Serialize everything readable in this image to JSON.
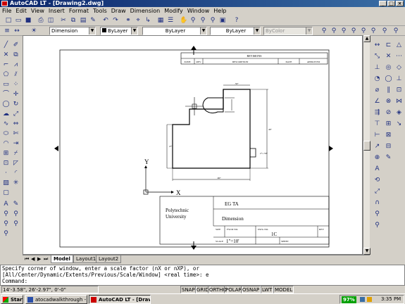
{
  "window": {
    "title": "AutoCAD LT - [Drawing2.dwg]",
    "buttons": [
      "_",
      "□",
      "×"
    ]
  },
  "menu": [
    "File",
    "Edit",
    "View",
    "Insert",
    "Format",
    "Tools",
    "Draw",
    "Dimension",
    "Modify",
    "Window",
    "Help"
  ],
  "props": {
    "dimstyle": "Dimension",
    "layer": "ByLayer",
    "linetype": "ByLayer",
    "lineweight": "ByLayer",
    "color": "ByColor"
  },
  "drawing": {
    "revisions_header": "REVISIONS",
    "rev_cols": [
      "ZONE",
      "REV",
      "DESCRIPTION",
      "DATE",
      "APPROVED"
    ],
    "company": "Polytechnic University",
    "company_lines": [
      "Polytechnic",
      "University"
    ],
    "name": "EG TA",
    "title": "Dimension",
    "size_label": "SIZE",
    "fscm_label": "FSCM NO.",
    "dwg_label": "DWG NO.",
    "dwg_no": "1C",
    "rev_label": "REV",
    "scale_label": "SCALE",
    "scale_value": "1\"=10'",
    "sheet_label": "SHEET",
    "axis_x": "X",
    "axis_y": "Y"
  },
  "layout_tabs": [
    "Model",
    "Layout1",
    "Layout2"
  ],
  "command_lines": [
    "Specify corner of window, enter a scale factor (nX or nXP), or",
    "[All/Center/Dynamic/Extents/Previous/Scale/Window] <real time>: e",
    "Command:"
  ],
  "status": {
    "coords": "14'-3.58\", 26'-2.97\", 0'-0\"",
    "toggles": [
      "SNAP",
      "GRID",
      "ORTHO",
      "POLAR",
      "OSNAP",
      "LWT",
      "MODEL"
    ]
  },
  "taskbar": {
    "start": "Start",
    "tasks": [
      "atocadwalkthrough - Mic...",
      "AutoCAD LT - [Drawin..."
    ],
    "battery": "97%",
    "time": "3:35 PM"
  },
  "colors": {
    "titlebar": "#0a246a",
    "accent_green": "#00a000"
  }
}
